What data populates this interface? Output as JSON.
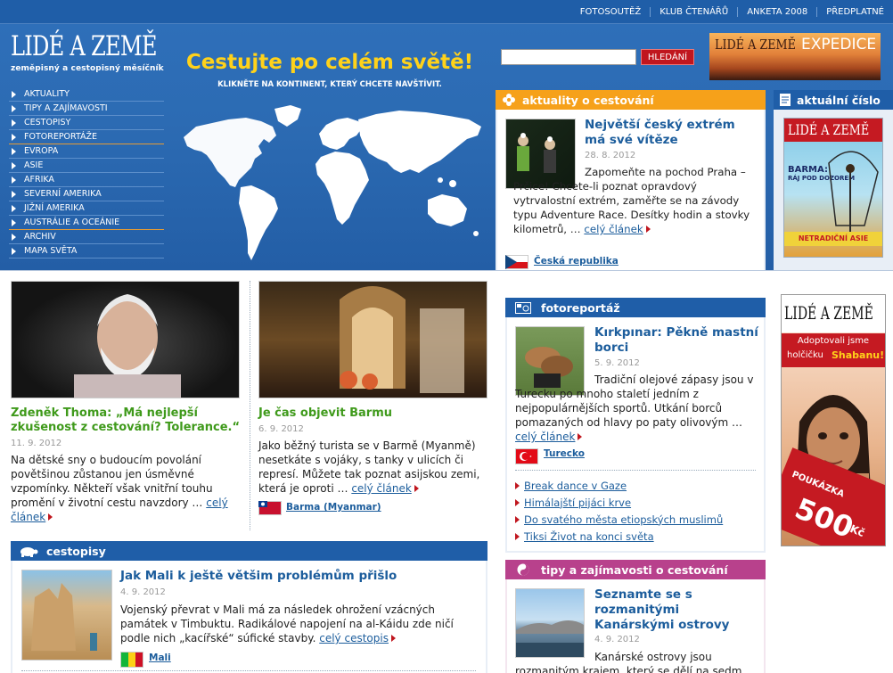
{
  "top_nav": [
    "FOTOSOUTĚŽ",
    "KLUB ČTENÁŘŮ",
    "ANKETA 2008",
    "PŘEDPLATNÉ"
  ],
  "logo": {
    "title": "LIDÉ A ZEMĚ",
    "subtitle": "zeměpisný a cestopisný měsíčník"
  },
  "nav": [
    "AKTUALITY",
    "TIPY A ZAJÍMAVOSTI",
    "CESTOPISY",
    "FOTOREPORTÁŽE",
    "EVROPA",
    "ASIE",
    "AFRIKA",
    "SEVERNÍ AMERIKA",
    "JIŽNÍ AMERIKA",
    "AUSTRÁLIE A OCEÁNIE",
    "ARCHIV",
    "MAPA SVĚTA"
  ],
  "headline": "Cestujte po celém světě!",
  "subheadline": "KLIKNĚTE NA KONTINENT, KTERÝ CHCETE NAVŠTÍVIT.",
  "search": {
    "value": "",
    "button": "HLEDÁNÍ"
  },
  "expedice": {
    "brand": "LIDÉ A ZEMĚ",
    "label": "EXPEDICE"
  },
  "aktuality": {
    "header": "aktuality o cestování",
    "title": "Největší český extrém má své vítěze",
    "date": "28. 8. 2012",
    "text": "Zapomeňte na pochod Praha – Prčice! Chcete-li poznat opravdový vytrvalostní extrém, zaměřte se na závody typu Adventure Race. Desítky hodin a stovky kilometrů, …",
    "more": "celý článek",
    "country": "Česká republika"
  },
  "cislo": {
    "header": "aktuální číslo",
    "cover_title": "LIDÉ A ZEMĚ",
    "cover_headline": "BARMA:",
    "cover_sub": "RÁJ POD DOZOREM",
    "cover_bottom": "NETRADIČNÍ ASIE"
  },
  "thoma": {
    "title": "Zdeněk Thoma: „Má nejlepší zkušenost z cestování? Tolerance.“",
    "date": "11. 9. 2012",
    "text": "Na dětské sny o budoucím povolání povětšinou zůstanou jen úsměvné vzpomínky. Někteří však vnitřní touhu promění v životní cestu navzdory …",
    "more": "celý článek"
  },
  "barma": {
    "title": "Je čas objevit Barmu",
    "date": "6. 9. 2012",
    "text": "Jako běžný turista se v Barmě (Myanmě) nesetkáte s vojáky, s tanky v ulicích či represí. Můžete tak poznat asijskou zemi, která je oproti …",
    "more": "celý článek",
    "country": "Barma (Myanmar)"
  },
  "fotoreportaz": {
    "header": "fotoreportáž",
    "title": "Kırkpınar: Pěkně mastní borci",
    "date": "5. 9. 2012",
    "text": "Tradiční olejové zápasy jsou v Turecku po mnoho staletí jedním z nejpopulárnějších sportů. Utkání borců pomazaných od hlavy po paty olivovým …",
    "more": "celý článek",
    "country": "Turecko",
    "links": [
      "Break dance v Gaze",
      "Himálajští pijáci krve",
      "Do svatého města etiopských muslimů",
      "Tiksi Život na konci světa"
    ]
  },
  "cestopisy": {
    "header": "cestopisy",
    "title": "Jak Mali k ještě většim problémům přišlo",
    "date": "4. 9. 2012",
    "text": "Vojenský převrat v Mali má za následek ohrožení vzácných památek v Timbuktu. Radikálové napojení na al-Káidu zde ničí podle nich „kacířské“ súfické stavby.",
    "more": "celý cestopis",
    "country": "Mali"
  },
  "tipy": {
    "header": "tipy a zajímavosti o cestování",
    "title": "Seznamte se s rozmanitými Kanárskými ostrovy",
    "date": "4. 9. 2012",
    "text": "Kanárské ostrovy jsou rozmanitým krajem, který se dělí na sedm"
  },
  "ad": {
    "brand": "LIDÉ A ZEMĚ",
    "line1": "Adoptovali jsme",
    "line2": "holčičku",
    "name": "Shabanu!",
    "voucher": "POUKÁZKA",
    "amount": "500",
    "currency": "Kč"
  },
  "colors": {
    "blue": "#1f5ea8",
    "orange": "#f6a11a",
    "purple": "#b8418c",
    "red": "#c0161e",
    "green": "#3f9a1b"
  }
}
